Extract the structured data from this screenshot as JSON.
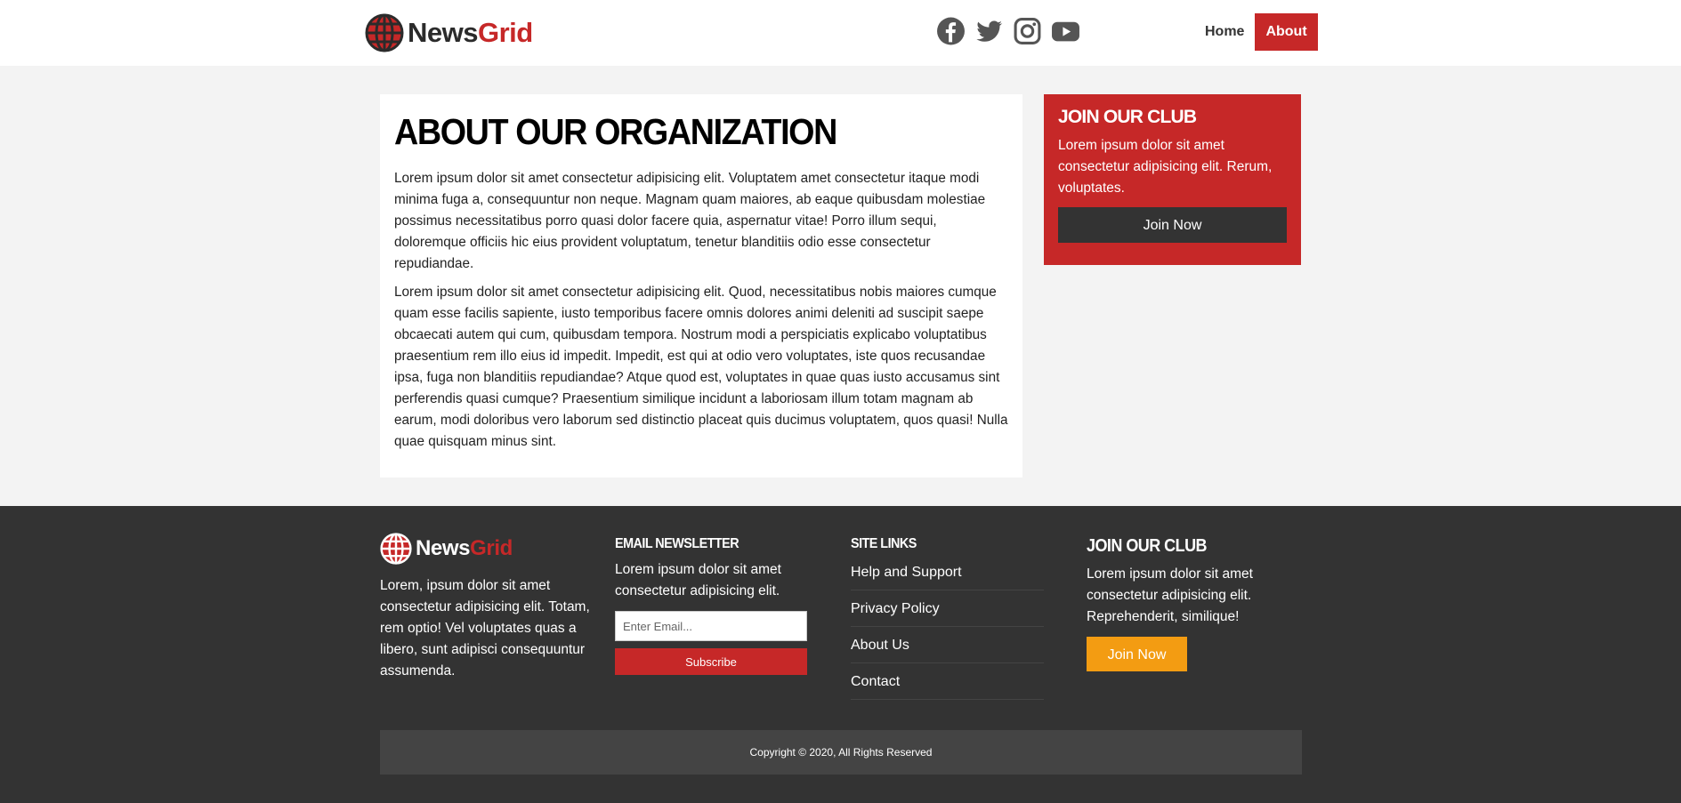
{
  "brand": {
    "name_part1": "News",
    "name_part2": "Grid",
    "accent": "#c62828"
  },
  "header": {
    "social_icons": [
      "facebook-icon",
      "twitter-icon",
      "instagram-icon",
      "youtube-icon"
    ],
    "nav": [
      {
        "label": "Home",
        "active": false
      },
      {
        "label": "About",
        "active": true
      }
    ]
  },
  "main": {
    "title": "About Our Organization",
    "paragraphs": [
      "Lorem ipsum dolor sit amet consectetur adipisicing elit. Voluptatem amet consectetur itaque modi minima fuga a, consequuntur non neque. Magnam quam maiores, ab eaque quibusdam molestiae possimus necessitatibus porro quasi dolor facere quia, aspernatur vitae! Porro illum sequi, doloremque officiis hic eius provident voluptatum, tenetur blanditiis odio esse consectetur repudiandae.",
      "Lorem ipsum dolor sit amet consectetur adipisicing elit. Quod, necessitatibus nobis maiores cumque quam esse facilis sapiente, iusto temporibus facere omnis dolores animi deleniti ad suscipit saepe obcaecati autem qui cum, quibusdam tempora. Nostrum modi a perspiciatis explicabo voluptatibus praesentium rem illo eius id impedit. Impedit, est qui at odio vero voluptates, iste quos recusandae ipsa, fuga non blanditiis repudiandae? Atque quod est, voluptates in quae quas iusto accusamus sint perferendis quasi cumque? Praesentium similique incidunt a laboriosam illum totam magnam ab earum, modi doloribus vero laborum sed distinctio placeat quis ducimus voluptatem, quos quasi! Nulla quae quisquam minus sint."
    ]
  },
  "sidebar": {
    "title": "Join Our Club",
    "text": "Lorem ipsum dolor sit amet consectetur adipisicing elit. Rerum, voluptates.",
    "button": "Join Now"
  },
  "footer": {
    "about_text": "Lorem, ipsum dolor sit amet consectetur adipisicing elit. Totam, rem optio! Vel voluptates quas a libero, sunt adipisci consequuntur assumenda.",
    "newsletter": {
      "heading": "Email Newsletter",
      "text": "Lorem ipsum dolor sit amet consectetur adipisicing elit.",
      "placeholder": "Enter Email...",
      "button": "Subscribe"
    },
    "site_links": {
      "heading": "Site Links",
      "items": [
        "Help and Support",
        "Privacy Policy",
        "About Us",
        "Contact"
      ]
    },
    "club": {
      "heading": "Join Our Club",
      "text": "Lorem ipsum dolor sit amet consectetur adipisicing elit. Reprehenderit, similique!",
      "button": "Join Now"
    },
    "copyright": "Copyright © 2020, All Rights Reserved"
  }
}
